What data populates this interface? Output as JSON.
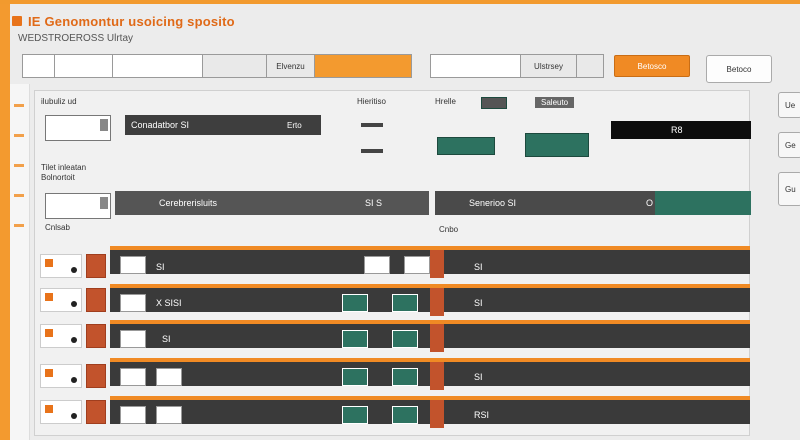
{
  "window": {
    "title_icon": "app-logo-icon",
    "title": "IE Genomontur usoicing sposito",
    "subtitle": "WEDSTROEROSS Ulrtay"
  },
  "toolbar": {
    "group1_mid": "Elvenzu",
    "group2_mid": "Ulstrsey",
    "orange_button": "Betosco",
    "white_button": "Betoco"
  },
  "panel": {
    "header_left": "ilubuliz ud",
    "header_mid": "Hieritiso",
    "header_right_1": "Hrelle",
    "header_right_2": "Saleuto",
    "row1_bar": "Conadatbor SI",
    "row1_mid": "Erto",
    "row1_dark": "R8",
    "section2_label_1": "Tilet inleatan",
    "section2_label_2": "Bolnortoit",
    "row2_bar": "Cerebrerisluits",
    "row2_value": "SI S",
    "row2_right": "Senerioo SI",
    "row2_right_value": "O SI",
    "footer_left": "Cnlsab",
    "footer_right": "Cnbo"
  },
  "rows": [
    {
      "left": "SI",
      "right": "SI"
    },
    {
      "left": "X SISI",
      "right": "SI"
    },
    {
      "left": "SI",
      "right": ""
    },
    {
      "left": "",
      "right": "SI"
    },
    {
      "left": "",
      "right": "RSI"
    }
  ],
  "side_buttons": [
    "Ue",
    "Ge",
    "Gu"
  ],
  "colors": {
    "accent": "#f08a24",
    "teal": "#2d7260",
    "dark": "#3a3a3a",
    "red": "#c2532c"
  }
}
